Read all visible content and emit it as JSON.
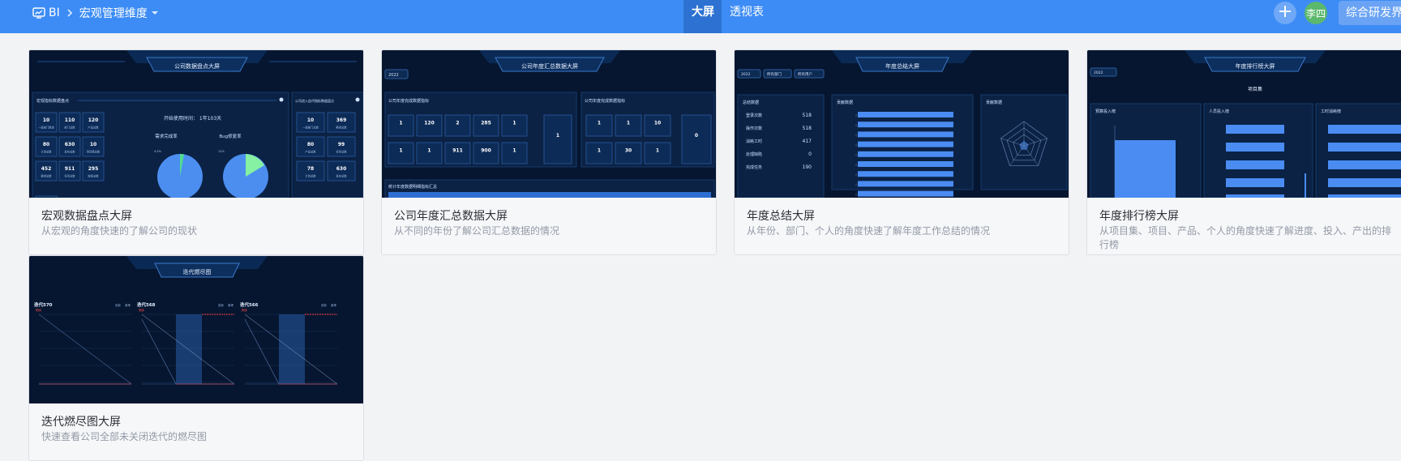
{
  "header": {
    "app_label": "BI",
    "module_label": "宏观管理维度",
    "tabs": [
      {
        "label": "大屏",
        "active": true
      },
      {
        "label": "透视表",
        "active": false
      }
    ],
    "user_avatar_text": "李四",
    "org_label": "综合研发界",
    "bar_color": "#3d8cf5"
  },
  "cards": [
    {
      "title": "宏观数据盘点大屏",
      "description": "从宏观的角度快速的了解公司的现状",
      "preview": {
        "screen_title": "公司数据盘点大屏",
        "panel_left": "宏观指标数据盘点",
        "panel_right": "公司进入迭代指标数据盘点",
        "usage": "开始使用时间： 1年103天",
        "pie_labels": [
          "需求完成率",
          "Bug修复率"
        ],
        "stats_left": [
          [
            "10",
            "一级部门数量"
          ],
          [
            "110",
            "部门总数"
          ],
          [
            "120",
            "产品总数"
          ],
          [
            "80",
            "计划总数"
          ],
          [
            "630",
            "发布总数"
          ],
          [
            "10",
            "项目集总数"
          ],
          [
            "452",
            "需求总数"
          ],
          [
            "911",
            "任务总数"
          ],
          [
            "295",
            "缺陷总数"
          ]
        ],
        "stats_right": [
          [
            "10",
            "一级部门总数"
          ],
          [
            "369",
            "需求总数"
          ],
          [
            "80",
            "产品总数"
          ],
          [
            "99",
            "任务总数"
          ],
          [
            "78",
            "计划总数"
          ],
          [
            "630",
            "发布总数"
          ]
        ]
      }
    },
    {
      "title": "公司年度汇总数据大屏",
      "description": "从不同的年份了解公司汇总数据的情况",
      "preview": {
        "screen_title": "公司年度汇总数据大屏",
        "year": "2022",
        "panel_a": "公司年度完成数据指标",
        "panel_b": "公司年度完成数据指标",
        "bottom_title": "统计年度数据明细指标汇总",
        "row1": [
          "1",
          "120",
          "2",
          "285",
          "1"
        ],
        "row2": [
          "1",
          "1",
          "911",
          "900",
          "1"
        ],
        "row3": [
          "1",
          "1",
          "10"
        ],
        "row4": [
          "1",
          "30",
          "1"
        ]
      }
    },
    {
      "title": "年度总结大屏",
      "description": "从年份、部门、个人的角度快速了解年度工作总结的情况",
      "preview": {
        "screen_title": "年度总结大屏",
        "filters": [
          "2022",
          "所有部门",
          "所有用户"
        ],
        "panel_a": "总结数据",
        "panel_b": "贡献数据",
        "panel_c": "贡献数据",
        "summary": [
          [
            "登录次数",
            "518"
          ],
          [
            "操作次数",
            "518"
          ],
          [
            "消耗工时",
            "417"
          ],
          [
            "处理缺陷",
            "0"
          ],
          [
            "完成任务",
            "190"
          ]
        ],
        "bar_values": [
          0.88,
          0.88,
          0.88,
          0.88,
          0.88,
          0.88,
          0.88,
          0.88,
          0.88
        ]
      }
    },
    {
      "title": "年度排行榜大屏",
      "description": "从项目集、项目、产品、个人的角度快速了解进度、投入、产出的排行榜",
      "preview": {
        "screen_title": "年度排行榜大屏",
        "year": "2022",
        "sub_title": "项目集",
        "panel_a": "预算投入榜",
        "panel_b": "人员投入榜",
        "panel_c": "工时消耗榜"
      }
    },
    {
      "title": "迭代燃尽图大屏",
      "description": "快速查看公司全部未关闭迭代的燃尽图",
      "preview": {
        "screen_title": "迭代燃尽图",
        "charts": [
          {
            "name": "迭代570",
            "sub": "剩余"
          },
          {
            "name": "迭代568",
            "sub": "剩余"
          },
          {
            "name": "迭代566",
            "sub": "剩余"
          }
        ],
        "legend": [
          "实际",
          "参考"
        ]
      }
    }
  ]
}
